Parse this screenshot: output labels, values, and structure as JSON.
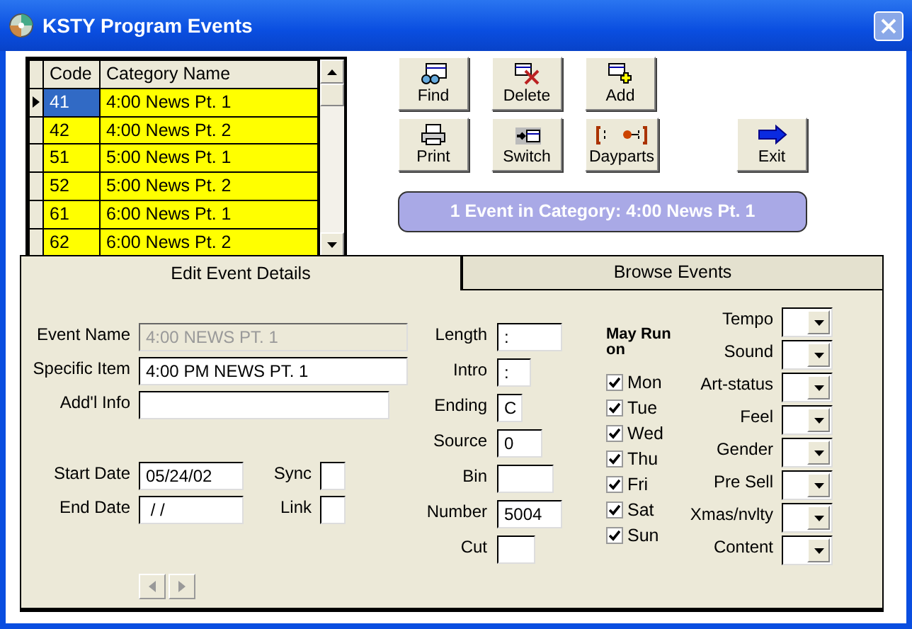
{
  "window": {
    "title": "KSTY Program Events"
  },
  "grid": {
    "columns": [
      "Code",
      "Category Name"
    ],
    "rows": [
      {
        "code": "41",
        "name": "4:00 News Pt. 1",
        "selected": true
      },
      {
        "code": "42",
        "name": "4:00 News Pt. 2",
        "selected": false
      },
      {
        "code": "51",
        "name": "5:00 News Pt. 1",
        "selected": false
      },
      {
        "code": "52",
        "name": "5:00 News Pt. 2",
        "selected": false
      },
      {
        "code": "61",
        "name": "6:00 News Pt. 1",
        "selected": false
      },
      {
        "code": "62",
        "name": "6:00 News Pt. 2",
        "selected": false
      }
    ]
  },
  "toolbar": [
    [
      {
        "label": "Find",
        "kind": "find"
      },
      {
        "label": "Delete",
        "kind": "delete"
      },
      {
        "label": "Add",
        "kind": "add"
      }
    ],
    [
      {
        "label": "Print",
        "kind": "print"
      },
      {
        "label": "Switch",
        "kind": "switch"
      },
      {
        "label": "Dayparts",
        "kind": "dayparts"
      },
      {
        "label": "Exit",
        "kind": "exit"
      }
    ]
  ],
  "status": "1 Event in Category: 4:00 News Pt. 1",
  "tabs": [
    {
      "label": "Edit Event Details",
      "selected": true
    },
    {
      "label": "Browse Events",
      "selected": false
    }
  ],
  "details": [
    {
      "label": "Event Name",
      "value": "4:00 NEWS PT. 1",
      "disabled": true
    },
    {
      "label": "Specific Item",
      "value": "4:00 PM NEWS PT. 1",
      "disabled": false
    },
    {
      "label": "Add'l Info",
      "disabled": false
    }
  ],
  "dates": [
    {
      "label": "Start Date",
      "value": "05/24/02",
      "flag_label": "Sync"
    },
    {
      "label": "End Date",
      "value": " / /",
      "flag_label": "Link"
    }
  ],
  "timing": [
    {
      "label": "Length",
      "value": ":"
    },
    {
      "label": "Intro",
      "value": ":"
    },
    {
      "label": "Ending",
      "value": "C"
    },
    {
      "label": "Source",
      "value": "0"
    },
    {
      "label": "Bin"
    },
    {
      "label": "Number",
      "value": "5004"
    },
    {
      "label": "Cut"
    }
  ],
  "run_days": {
    "title": "May Run on",
    "days": [
      {
        "label": "Mon",
        "checked": true
      },
      {
        "label": "Tue",
        "checked": true
      },
      {
        "label": "Wed",
        "checked": true
      },
      {
        "label": "Thu",
        "checked": true
      },
      {
        "label": "Fri",
        "checked": true
      },
      {
        "label": "Sat",
        "checked": true
      },
      {
        "label": "Sun",
        "checked": true
      }
    ]
  },
  "attributes": [
    {
      "label": "Tempo"
    },
    {
      "label": "Sound"
    },
    {
      "label": "Art-status"
    },
    {
      "label": "Feel"
    },
    {
      "label": "Gender"
    },
    {
      "label": "Pre Sell"
    },
    {
      "label": "Xmas/nvlty"
    },
    {
      "label": "Content"
    }
  ]
}
